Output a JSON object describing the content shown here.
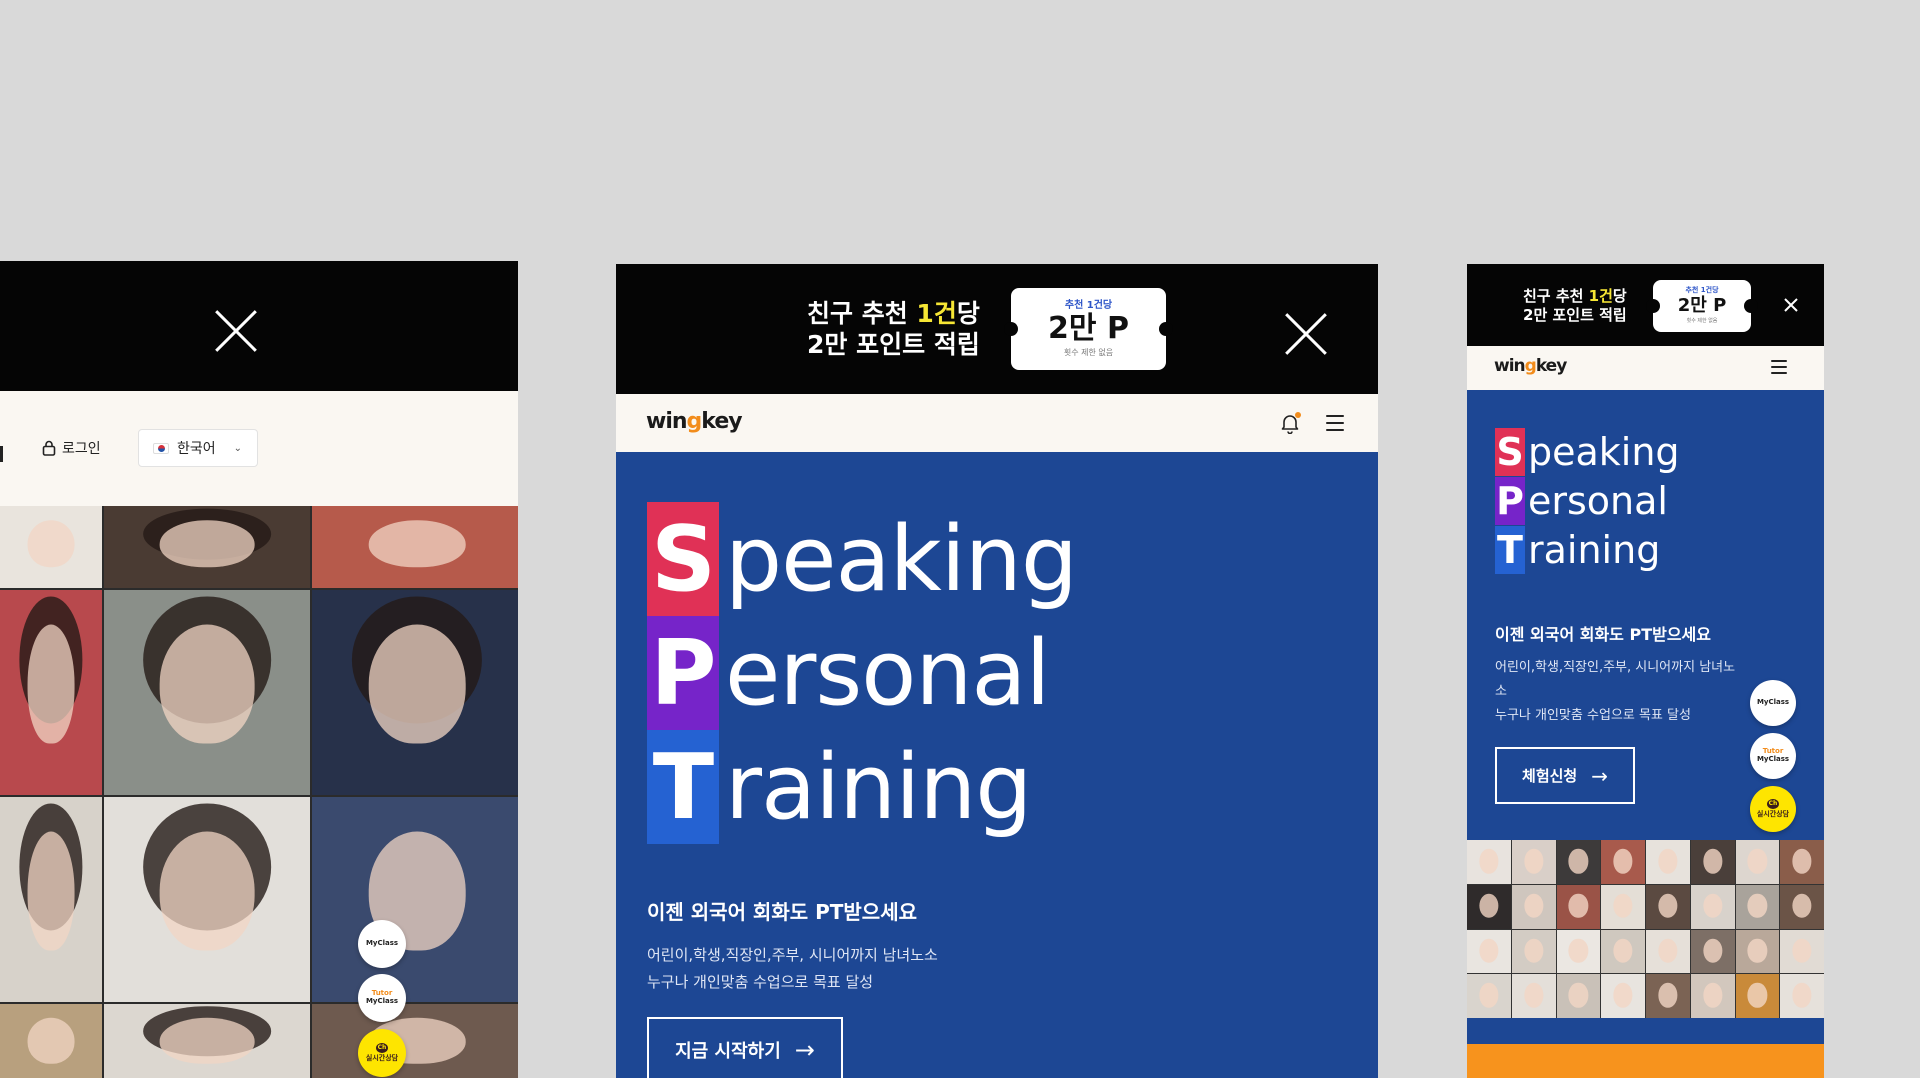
{
  "promo": {
    "line1_prefix": "친구 추천 ",
    "line1_highlight": "1건",
    "line1_suffix": "당",
    "line2": "2만 포인트 적립",
    "ticket_top": "추천 1건당",
    "ticket_big": "2만 P",
    "ticket_small": "횟수 제한 없음"
  },
  "header": {
    "logo_a": "win",
    "logo_g": "g",
    "logo_b": "key",
    "login": "로그인",
    "language": "한국어"
  },
  "hero": {
    "cap_s": "S",
    "rest_s": "peaking",
    "cap_p": "P",
    "rest_p": "ersonal",
    "cap_t": "T",
    "rest_t": "raining",
    "subtitle": "이젠 외국어 회화도 PT받으세요",
    "desc_line1": "어린이,학생,직장인,주부, 시니어까지 남녀노소",
    "desc_line2": "누구나 개인맞춤 수업으로 목표 달성",
    "desc_line1_mobile": "어린이,학생,직장인,주부, 시니어까지 남녀노소",
    "desc_line2_mobile": "누구나 개인맞춤 수업으로 목표 달성",
    "cta_tablet": "지금 시작하기",
    "cta_mobile": "체험신청"
  },
  "floating": {
    "myclass": "MyClass",
    "tutor": "Tutor",
    "tutor_myclass": "MyClass",
    "kakao": "실시간상담",
    "kakao_badge": "Ch"
  },
  "colors": {
    "background": "#d9d9d9",
    "hero_blue": "#1d4794",
    "cap_s": "#e03156",
    "cap_p": "#7624c9",
    "cap_t": "#2562d2",
    "promo_highlight": "#f6e634",
    "accent_orange": "#f28c1b",
    "kakao_yellow": "#fee500"
  },
  "icons": {
    "close": "close-icon",
    "bell": "bell-icon",
    "menu": "hamburger-menu-icon",
    "lock": "lock-icon",
    "flag": "korea-flag-icon",
    "chevron": "chevron-down-icon",
    "arrow": "arrow-right-icon"
  }
}
